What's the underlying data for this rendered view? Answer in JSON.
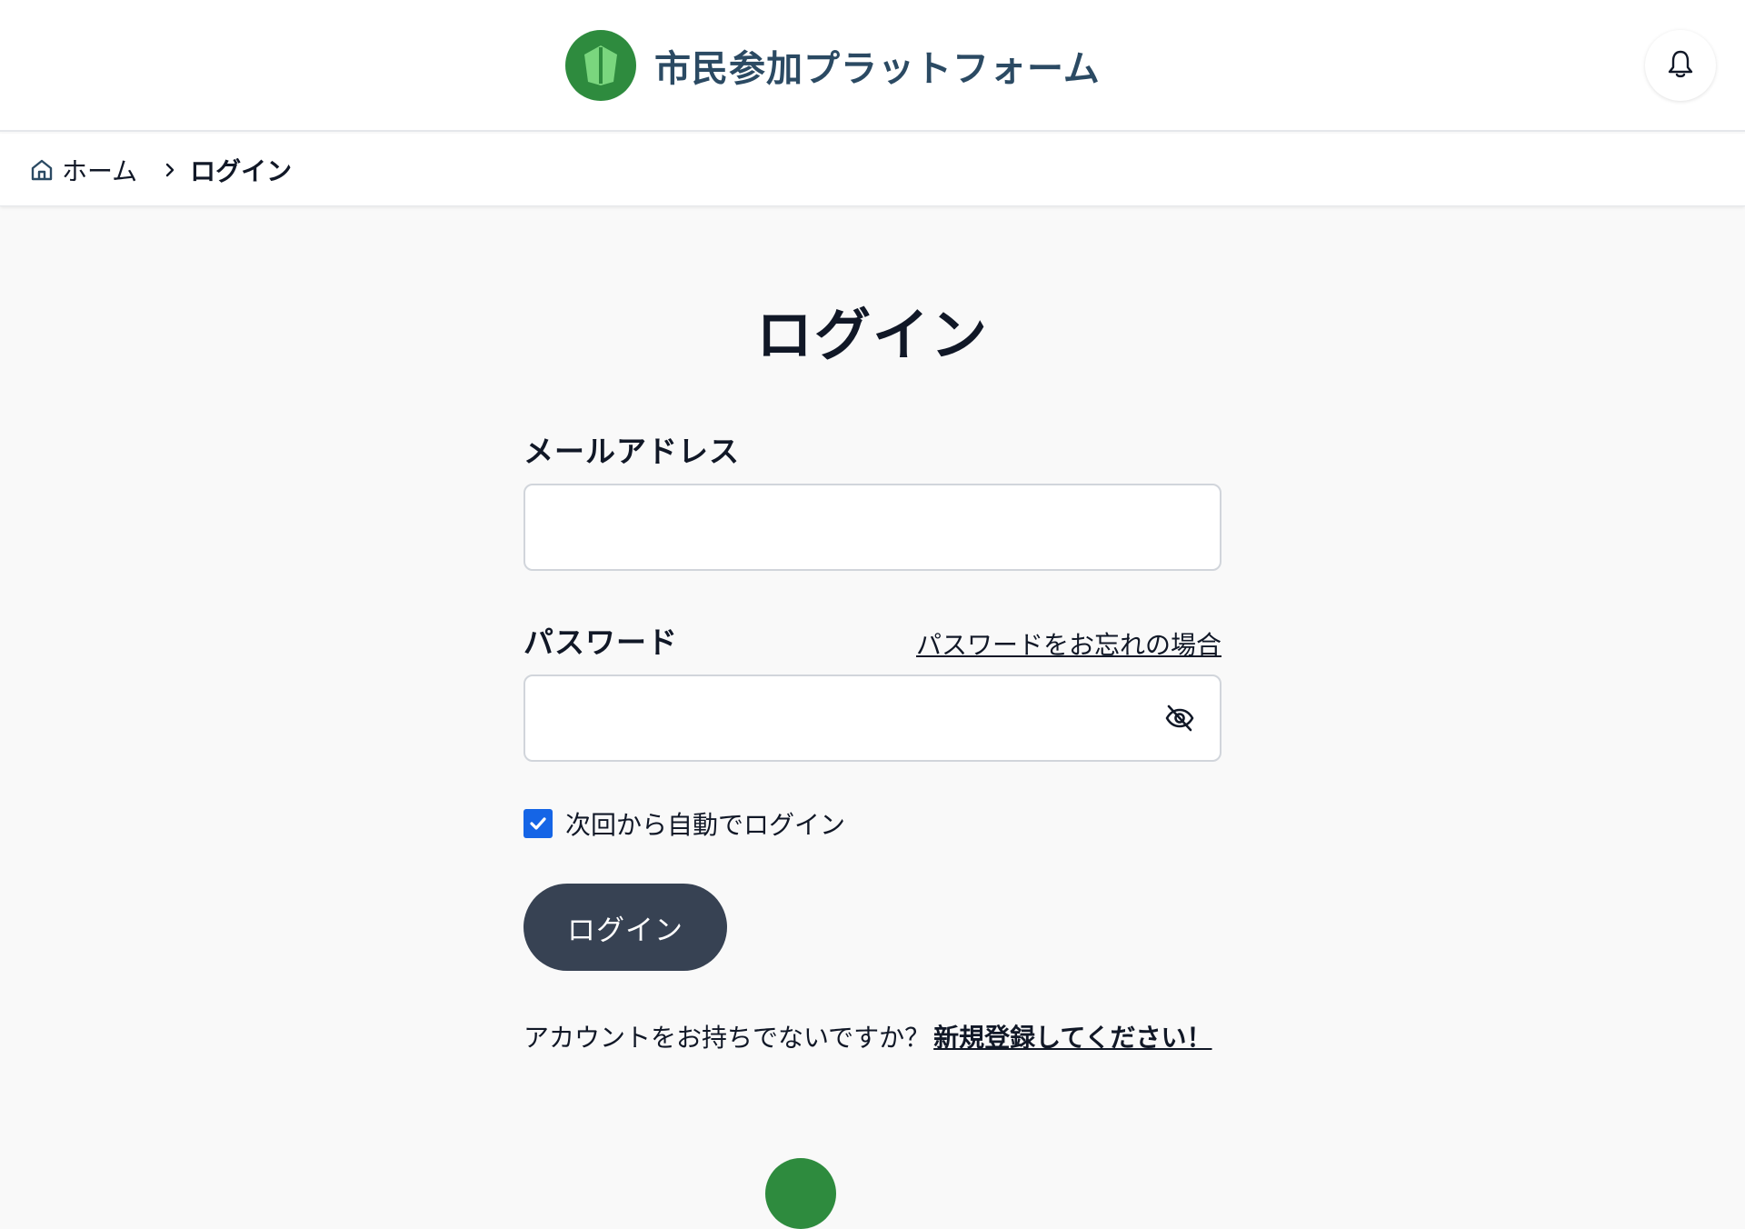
{
  "header": {
    "site_title": "市民参加プラットフォーム",
    "logo_icon": "leaf-shield-logo",
    "notification_icon": "bell-icon"
  },
  "breadcrumb": {
    "home_label": "ホーム",
    "current_label": "ログイン"
  },
  "main": {
    "title": "ログイン",
    "email": {
      "label": "メールアドレス",
      "value": "",
      "placeholder": ""
    },
    "password": {
      "label": "パスワード",
      "forgot_link": "パスワードをお忘れの場合",
      "value": "",
      "placeholder": "",
      "toggle_icon": "eye-off-icon"
    },
    "remember": {
      "label": "次回から自動でログイン",
      "checked": true
    },
    "submit_label": "ログイン",
    "signup": {
      "prompt": "アカウントをお持ちでないですか？",
      "link": "新規登録してください！"
    }
  },
  "colors": {
    "brand_green": "#2e8b3e",
    "title_blue": "#2b4a63",
    "button_dark": "#374253",
    "checkbox_blue": "#1565e6",
    "page_bg": "#f9f9f9"
  }
}
